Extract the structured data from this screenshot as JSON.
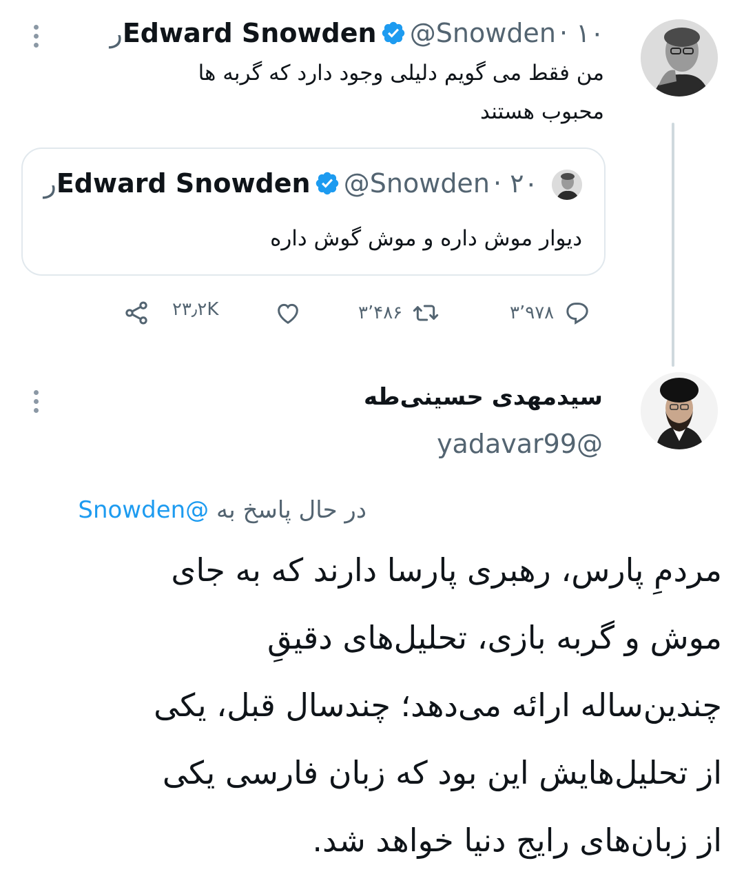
{
  "tweet": {
    "author_name": "Edward Snowden",
    "author_handle": "@Snowden",
    "time": "۱۰ر",
    "text_line1": "من فقط می گویم دلیلی وجود دارد که گربه ها",
    "text_line2": "محبوب هستند"
  },
  "quoted": {
    "author_name": "Edward Snowden",
    "author_handle": "@Snowden",
    "time": "۲۰ر",
    "text": "دیوار موش داره و موش گوش داره"
  },
  "actions": {
    "replies": "۳٬۹۷۸",
    "retweets": "۳٬۴۸۶",
    "likes": "۲۳٫۲K"
  },
  "reply": {
    "author_name": "سیدمهدی حسینی‌طه",
    "author_handle": "@yadavar99",
    "replying_label": "در حال پاسخ به",
    "replying_to": "@Snowden",
    "lines": [
      "مردمِ پارس، رهبری پارسا دارند که به جای",
      "موش و گربه بازی، تحلیل‌های دقیقِ",
      "چندین‌ساله ارائه می‌دهد؛ چندسال قبل، یکی",
      "از تحلیل‌هایش این بود که زبان فارسی یکی",
      "از زبان‌های رایج دنیا خواهد شد."
    ]
  },
  "colors": {
    "accent": "#1d9bf0",
    "muted": "#536471",
    "text": "#0f1419"
  },
  "icons": [
    "more-icon",
    "verified-icon",
    "reply-icon",
    "retweet-icon",
    "like-icon",
    "share-icon"
  ]
}
